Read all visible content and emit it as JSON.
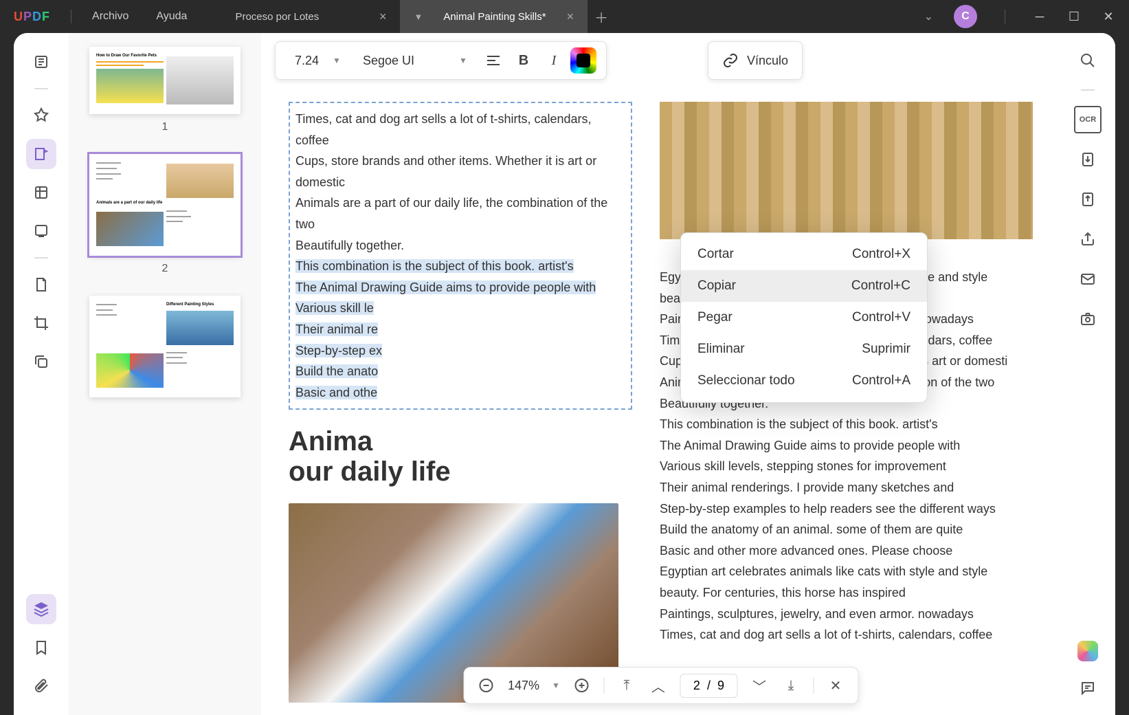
{
  "app": {
    "logo": "UPDF",
    "avatar_letter": "C"
  },
  "menu": {
    "archivo": "Archivo",
    "ayuda": "Ayuda"
  },
  "tabs": {
    "items": [
      {
        "title": "Proceso por Lotes",
        "active": false
      },
      {
        "title": "Animal Painting Skills*",
        "active": true
      }
    ]
  },
  "format": {
    "font_size": "7.24",
    "font_family": "Segoe UI",
    "link_label": "Vínculo"
  },
  "context_menu": {
    "items": [
      {
        "label": "Cortar",
        "shortcut": "Control+X"
      },
      {
        "label": "Copiar",
        "shortcut": "Control+C"
      },
      {
        "label": "Pegar",
        "shortcut": "Control+V"
      },
      {
        "label": "Eliminar",
        "shortcut": "Suprimir"
      },
      {
        "label": "Seleccionar todo",
        "shortcut": "Control+A"
      }
    ],
    "hover_index": 1
  },
  "doc_left": {
    "para1_lines": [
      "Times, cat and dog art sells a lot of t-shirts, calendars, coffee",
      "Cups, store brands and other items. Whether it is art or domestic",
      "Animals are a part of our daily life, the combination of the two",
      "Beautifully together."
    ],
    "selected_lines": [
      "This combination is the subject of this book. artist's",
      "The Animal Drawing Guide aims to provide people with",
      "Various skill le",
      "Their animal re",
      "Step-by-step ex",
      "Build the anato",
      "Basic and othe"
    ],
    "heading_l1": "Anima",
    "heading_l2": "our daily life"
  },
  "doc_right": {
    "lines": [
      "Egyptian art celebrates animals like cats with style and style",
      "beauty. For centuries, this horse has inspired",
      "Paintings, sculptures, jewelry, and even armor. nowadays",
      "Times, cat and dog art sells a lot of t-shirts, calendars, coffee",
      "Cups, store brands and other items. Whether it is art or domesti",
      "Animals are a part of our daily life, the combination of the two",
      "Beautifully together.",
      "This combination is the subject of this book. artist's",
      "The Animal Drawing Guide aims to provide people with",
      "Various skill levels, stepping stones for improvement",
      "Their animal renderings. I provide many sketches and",
      "Step-by-step examples to help readers see the different ways",
      "Build the anatomy of an animal. some of them are quite",
      "Basic and other more advanced ones. Please choose",
      "Egyptian art celebrates animals like cats with style and style",
      "beauty. For centuries, this horse has inspired",
      "Paintings, sculptures, jewelry, and even armor. nowadays",
      "Times, cat and dog art sells a lot of t-shirts, calendars, coffee"
    ]
  },
  "thumbs": {
    "p1_num": "1",
    "p2_num": "2",
    "p1_title": "How to Draw Our Favorite Pets",
    "p2_title": "Animals are a part of our daily life",
    "p3_title": "Different Painting Styles"
  },
  "nav": {
    "zoom": "147%",
    "page_current": "2",
    "page_sep": "/",
    "page_total": "9"
  }
}
